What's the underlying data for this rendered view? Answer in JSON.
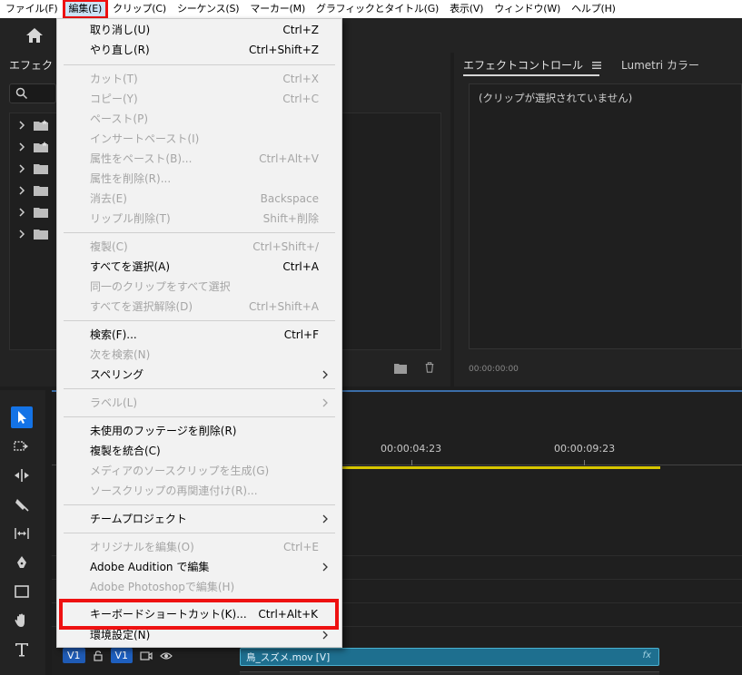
{
  "menubar": {
    "items": [
      {
        "label": "ファイル(F)"
      },
      {
        "label": "編集(E)"
      },
      {
        "label": "クリップ(C)"
      },
      {
        "label": "シーケンス(S)"
      },
      {
        "label": "マーカー(M)"
      },
      {
        "label": "グラフィックとタイトル(G)"
      },
      {
        "label": "表示(V)"
      },
      {
        "label": "ウィンドウ(W)"
      },
      {
        "label": "ヘルプ(H)"
      }
    ]
  },
  "effects_panel": {
    "tab_label": "エフェクト"
  },
  "effect_controls": {
    "tab_label": "エフェクトコントロール",
    "tab_menu_icon": "hamburger-icon",
    "lumetri_tab": "Lumetri カラー",
    "message": "(クリップが選択されていません)",
    "timecode": "00:00:00:00"
  },
  "timeline": {
    "timecodes": [
      "00:00:04:23",
      "00:00:09:23"
    ],
    "track_v1_source": "V1",
    "track_v1_target": "V1",
    "clip_name": "鳥_スズメ.mov [V]",
    "clip_fx": "fx"
  },
  "edit_menu": {
    "items": [
      {
        "label": "取り消し(U)",
        "shortcut": "Ctrl+Z",
        "disabled": false
      },
      {
        "label": "やり直し(R)",
        "shortcut": "Ctrl+Shift+Z",
        "disabled": false
      },
      {
        "label": "カット(T)",
        "shortcut": "Ctrl+X",
        "disabled": true
      },
      {
        "label": "コピー(Y)",
        "shortcut": "Ctrl+C",
        "disabled": true
      },
      {
        "label": "ペースト(P)",
        "shortcut": "",
        "disabled": true
      },
      {
        "label": "インサートペースト(I)",
        "shortcut": "",
        "disabled": true
      },
      {
        "label": "属性をペースト(B)...",
        "shortcut": "Ctrl+Alt+V",
        "disabled": true
      },
      {
        "label": "属性を削除(R)...",
        "shortcut": "",
        "disabled": true
      },
      {
        "label": "消去(E)",
        "shortcut": "Backspace",
        "disabled": true
      },
      {
        "label": "リップル削除(T)",
        "shortcut": "Shift+削除",
        "disabled": true
      },
      {
        "label": "複製(C)",
        "shortcut": "Ctrl+Shift+/",
        "disabled": true
      },
      {
        "label": "すべてを選択(A)",
        "shortcut": "Ctrl+A",
        "disabled": false
      },
      {
        "label": "同一のクリップをすべて選択",
        "shortcut": "",
        "disabled": true
      },
      {
        "label": "すべてを選択解除(D)",
        "shortcut": "Ctrl+Shift+A",
        "disabled": true
      },
      {
        "label": "検索(F)...",
        "shortcut": "Ctrl+F",
        "disabled": false
      },
      {
        "label": "次を検索(N)",
        "shortcut": "",
        "disabled": true
      },
      {
        "label": "スペリング",
        "shortcut": "",
        "disabled": false
      },
      {
        "label": "ラベル(L)",
        "shortcut": "",
        "disabled": true
      },
      {
        "label": "未使用のフッテージを削除(R)",
        "shortcut": "",
        "disabled": false
      },
      {
        "label": "複製を統合(C)",
        "shortcut": "",
        "disabled": false
      },
      {
        "label": "メディアのソースクリップを生成(G)",
        "shortcut": "",
        "disabled": true
      },
      {
        "label": "ソースクリップの再関連付け(R)...",
        "shortcut": "",
        "disabled": true
      },
      {
        "label": "チームプロジェクト",
        "shortcut": "",
        "disabled": false
      },
      {
        "label": "オリジナルを編集(O)",
        "shortcut": "Ctrl+E",
        "disabled": true
      },
      {
        "label": "Adobe Audition で編集",
        "shortcut": "",
        "disabled": false
      },
      {
        "label": "Adobe Photoshopで編集(H)",
        "shortcut": "",
        "disabled": true
      },
      {
        "label": "キーボードショートカット(K)...",
        "shortcut": "Ctrl+Alt+K",
        "disabled": false
      },
      {
        "label": "環境設定(N)",
        "shortcut": "",
        "disabled": false
      }
    ]
  },
  "colors": {
    "highlight_red": "#ee1111",
    "accent_blue": "#1473e6",
    "workarea_yellow": "#d8c600"
  },
  "icons": {
    "home": "home-icon",
    "search": "search-icon",
    "folder": "folder-icon",
    "trash": "trash-icon",
    "submenu": "chevron-right-icon"
  }
}
